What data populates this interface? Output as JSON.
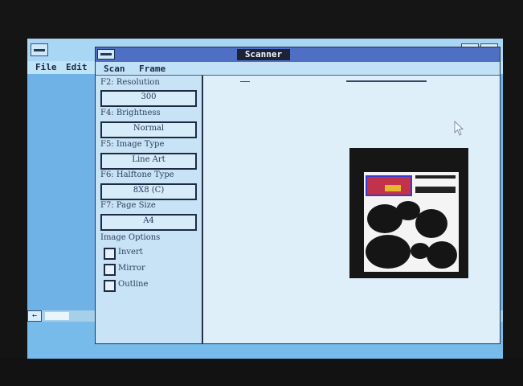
{
  "outer_window": {
    "menu": [
      "File",
      "Edit"
    ],
    "max_icon": "⇩",
    "restore_icon": "⇳",
    "hscroll_left_icon": "←",
    "hscroll_right_icon": "→"
  },
  "scanner_window": {
    "title": "Scanner",
    "menu": [
      "Scan",
      "Frame"
    ]
  },
  "options": {
    "resolution": {
      "label": "F2: Resolution",
      "value": "300"
    },
    "brightness": {
      "label": "F4: Brightness",
      "value": "Normal"
    },
    "image_type": {
      "label": "F5: Image Type",
      "value": "Line Art"
    },
    "halftone_type": {
      "label": "F6: Halftone Type",
      "value": "8X8 (C)"
    },
    "page_size": {
      "label": "F7: Page Size",
      "value": "A4"
    },
    "image_options": {
      "label": "Image Options",
      "items": [
        {
          "label": "Invert",
          "checked": false
        },
        {
          "label": "Mirror",
          "checked": false
        },
        {
          "label": "Outline",
          "checked": false
        }
      ]
    }
  },
  "scroll": {
    "up_icon": "↑",
    "down_icon": "↓",
    "corner_icon": "➡"
  },
  "colors": {
    "desktop": "#6fb3e6",
    "scanner_titlebar": "#4f6fc4",
    "panel": "#c8e3f5",
    "preview": "#dfeffa"
  }
}
